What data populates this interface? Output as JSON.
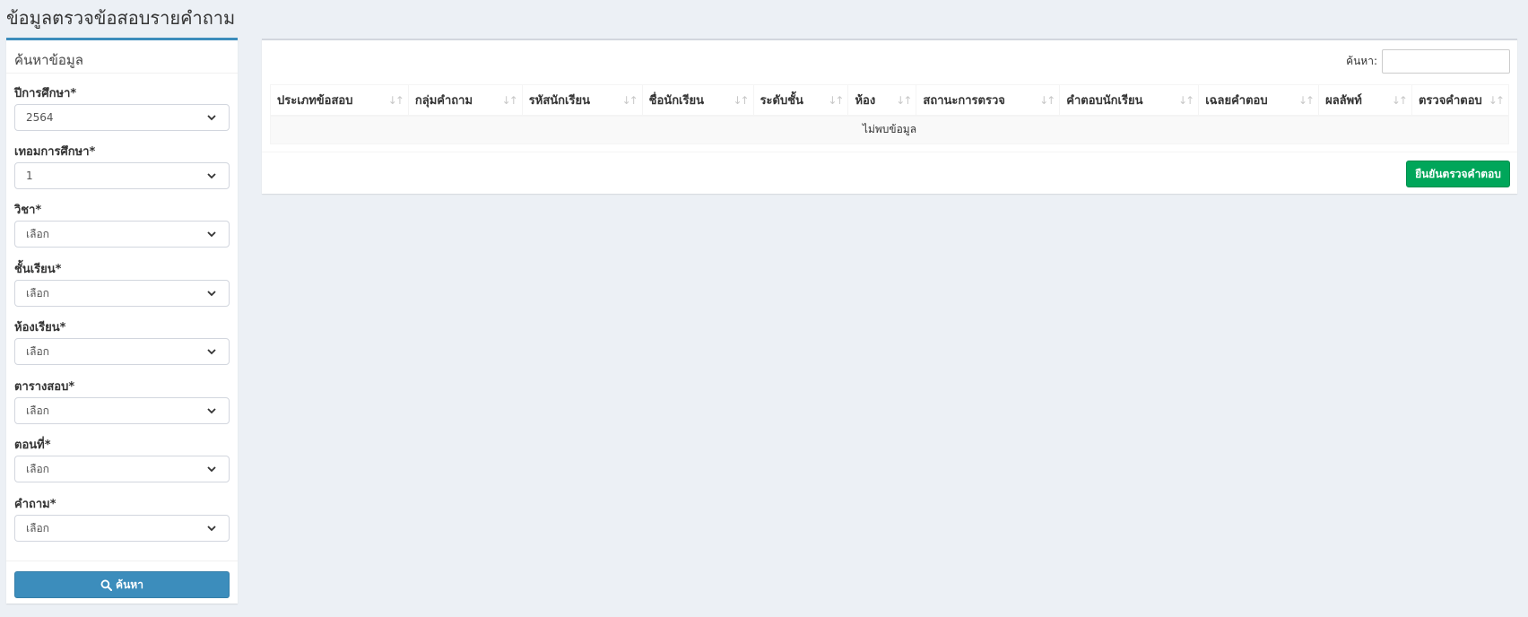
{
  "page": {
    "title": "ข้อมูลตรวจข้อสอบรายคำถาม"
  },
  "filters": {
    "title": "ค้นหาข้อมูล",
    "fields": [
      {
        "label": "ปีการศึกษา*",
        "value": "2564"
      },
      {
        "label": "เทอมการศึกษา*",
        "value": "1"
      },
      {
        "label": "วิชา*",
        "value": "เลือก"
      },
      {
        "label": "ชั้นเรียน*",
        "value": "เลือก"
      },
      {
        "label": "ห้องเรียน*",
        "value": "เลือก"
      },
      {
        "label": "ตารางสอบ*",
        "value": "เลือก"
      },
      {
        "label": "ตอนที่*",
        "value": "เลือก"
      },
      {
        "label": "คำถาม*",
        "value": "เลือก"
      }
    ],
    "search_button": "ค้นหา"
  },
  "results": {
    "search_label": "ค้นหา:",
    "columns": [
      "ประเภทข้อสอบ",
      "กลุ่มคำถาม",
      "รหัสนักเรียน",
      "ชื่อนักเรียน",
      "ระดับชั้น",
      "ห้อง",
      "สถานะการตรวจ",
      "คำตอบนักเรียน",
      "เฉลยคำตอบ",
      "ผลลัพท์",
      "ตรวจคำตอบ"
    ],
    "empty_message": "ไม่พบข้อมูล",
    "confirm_button": "ยืนยันตรวจคำตอบ"
  },
  "colors": {
    "primary": "#3c8dbc",
    "success": "#00a65a",
    "background": "#ecf0f5"
  },
  "icons": [
    "search-icon",
    "chevron-down-icon",
    "sort-icon"
  ]
}
